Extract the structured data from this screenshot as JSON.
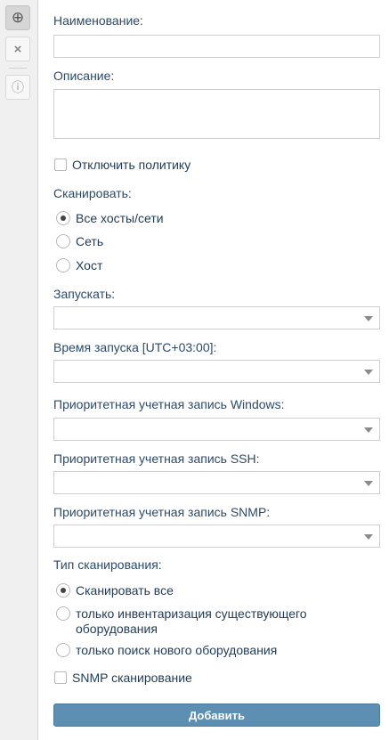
{
  "toolbar": {
    "buttons": [
      {
        "icon": "plus-circle-icon",
        "glyph": "⊕"
      },
      {
        "icon": "close-icon",
        "glyph": "×"
      },
      {
        "icon": "info-icon",
        "glyph": "ⓘ"
      }
    ]
  },
  "form": {
    "name_label": "Наименование:",
    "name_value": "",
    "description_label": "Описание:",
    "description_value": "",
    "disable_policy_label": "Отключить политику",
    "disable_policy_checked": false,
    "scan_label": "Сканировать:",
    "scan_options": [
      "Все хосты/сети",
      "Сеть",
      "Хост"
    ],
    "scan_selected": "Все хосты/сети",
    "run_label": "Запускать:",
    "run_value": "",
    "start_time_label": "Время запуска [UTC+03:00]:",
    "start_time_value": "",
    "windows_account_label": "Приоритетная учетная запись Windows:",
    "windows_account_value": "",
    "ssh_account_label": "Приоритетная учетная запись SSH:",
    "ssh_account_value": "",
    "snmp_account_label": "Приоритетная учетная запись SNMP:",
    "snmp_account_value": "",
    "scan_type_label": "Тип сканирования:",
    "scan_type_options": [
      "Сканировать все",
      "только инвентаризация существующего",
      "оборудования",
      "только поиск нового оборудования"
    ],
    "scan_type_selected": "Сканировать все",
    "snmp_scan_label": "SNMP сканирование",
    "snmp_scan_checked": false,
    "submit_label": "Добавить"
  },
  "colors": {
    "label_text": "#2b4a6a",
    "button_bg": "#5d8fb3",
    "toolbar_bg": "#f0f0f0"
  }
}
